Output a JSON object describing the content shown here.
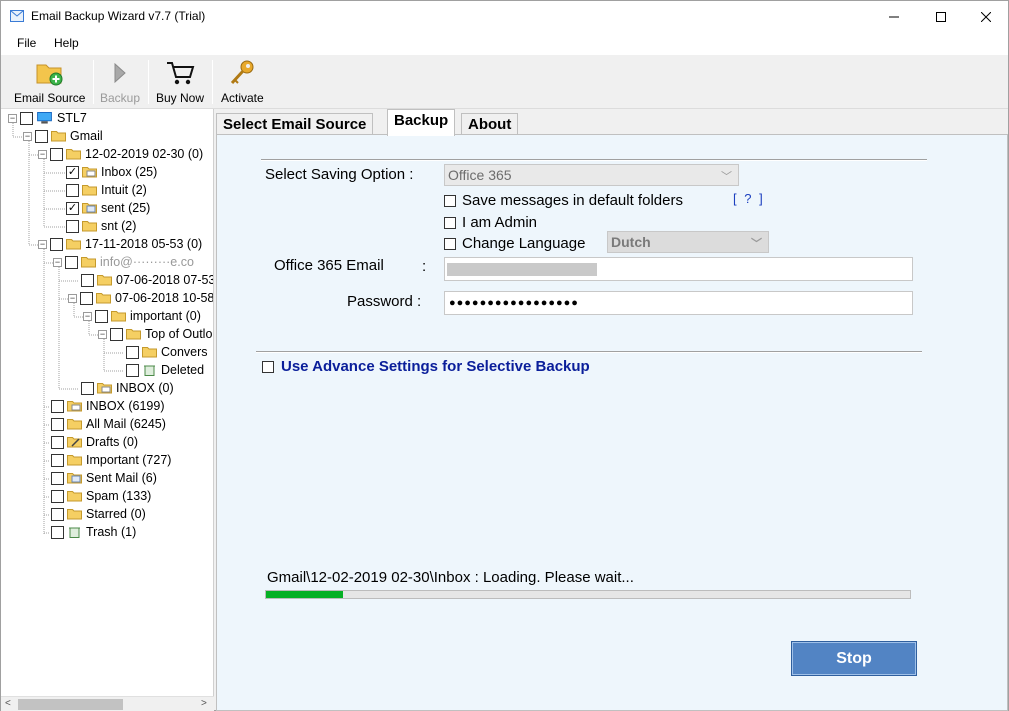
{
  "window": {
    "title": "Email Backup Wizard v7.7 (Trial)"
  },
  "menu": {
    "file": "File",
    "help": "Help"
  },
  "toolbar": {
    "email_source": "Email Source",
    "backup": "Backup",
    "buy_now": "Buy Now",
    "activate": "Activate"
  },
  "tree": {
    "root": "STL7",
    "gmail": "Gmail",
    "folder1": "12-02-2019 02-30 (0)",
    "inbox": "Inbox (25)",
    "intuit": "Intuit (2)",
    "sent": "sent (25)",
    "snt": "snt (2)",
    "folder2": "17-11-2018 05-53 (0)",
    "account": "info@·········e.co",
    "sub1": "07-06-2018 07-53",
    "sub2": "07-06-2018 10-58",
    "important0": "important (0)",
    "top_outlook": "Top of Outlo",
    "convers": "Convers",
    "deleted": "Deleted",
    "inbox0": "INBOX (0)",
    "inbox_big": "INBOX (6199)",
    "all_mail": "All Mail (6245)",
    "drafts": "Drafts (0)",
    "important727": "Important (727)",
    "sent_mail": "Sent Mail (6)",
    "spam": "Spam (133)",
    "starred": "Starred (0)",
    "trash": "Trash (1)"
  },
  "tabs": {
    "select_source": "Select Email Source",
    "backup": "Backup",
    "about": "About"
  },
  "backup": {
    "saving_option_label": "Select Saving Option :",
    "saving_option_value": "Office 365",
    "save_default_folders": "Save messages in default folders",
    "help_link": "[ ? ]",
    "admin": "I am Admin",
    "change_language": "Change Language",
    "language_value": "Dutch",
    "email_label": "Office 365 Email",
    "email_colon": ":",
    "password_label": "Password :",
    "password_value": "●●●●●●●●●●●●●●●●●",
    "advance_settings": "Use Advance Settings for Selective Backup",
    "status": "Gmail\\12-02-2019 02-30\\Inbox : Loading. Please wait...",
    "progress": 0.12,
    "stop": "Stop"
  },
  "colors": {
    "accent": "#5284c4",
    "progress_fill": "#06b025",
    "panel_bg": "#eef6fc",
    "link": "#0a1e9a"
  }
}
